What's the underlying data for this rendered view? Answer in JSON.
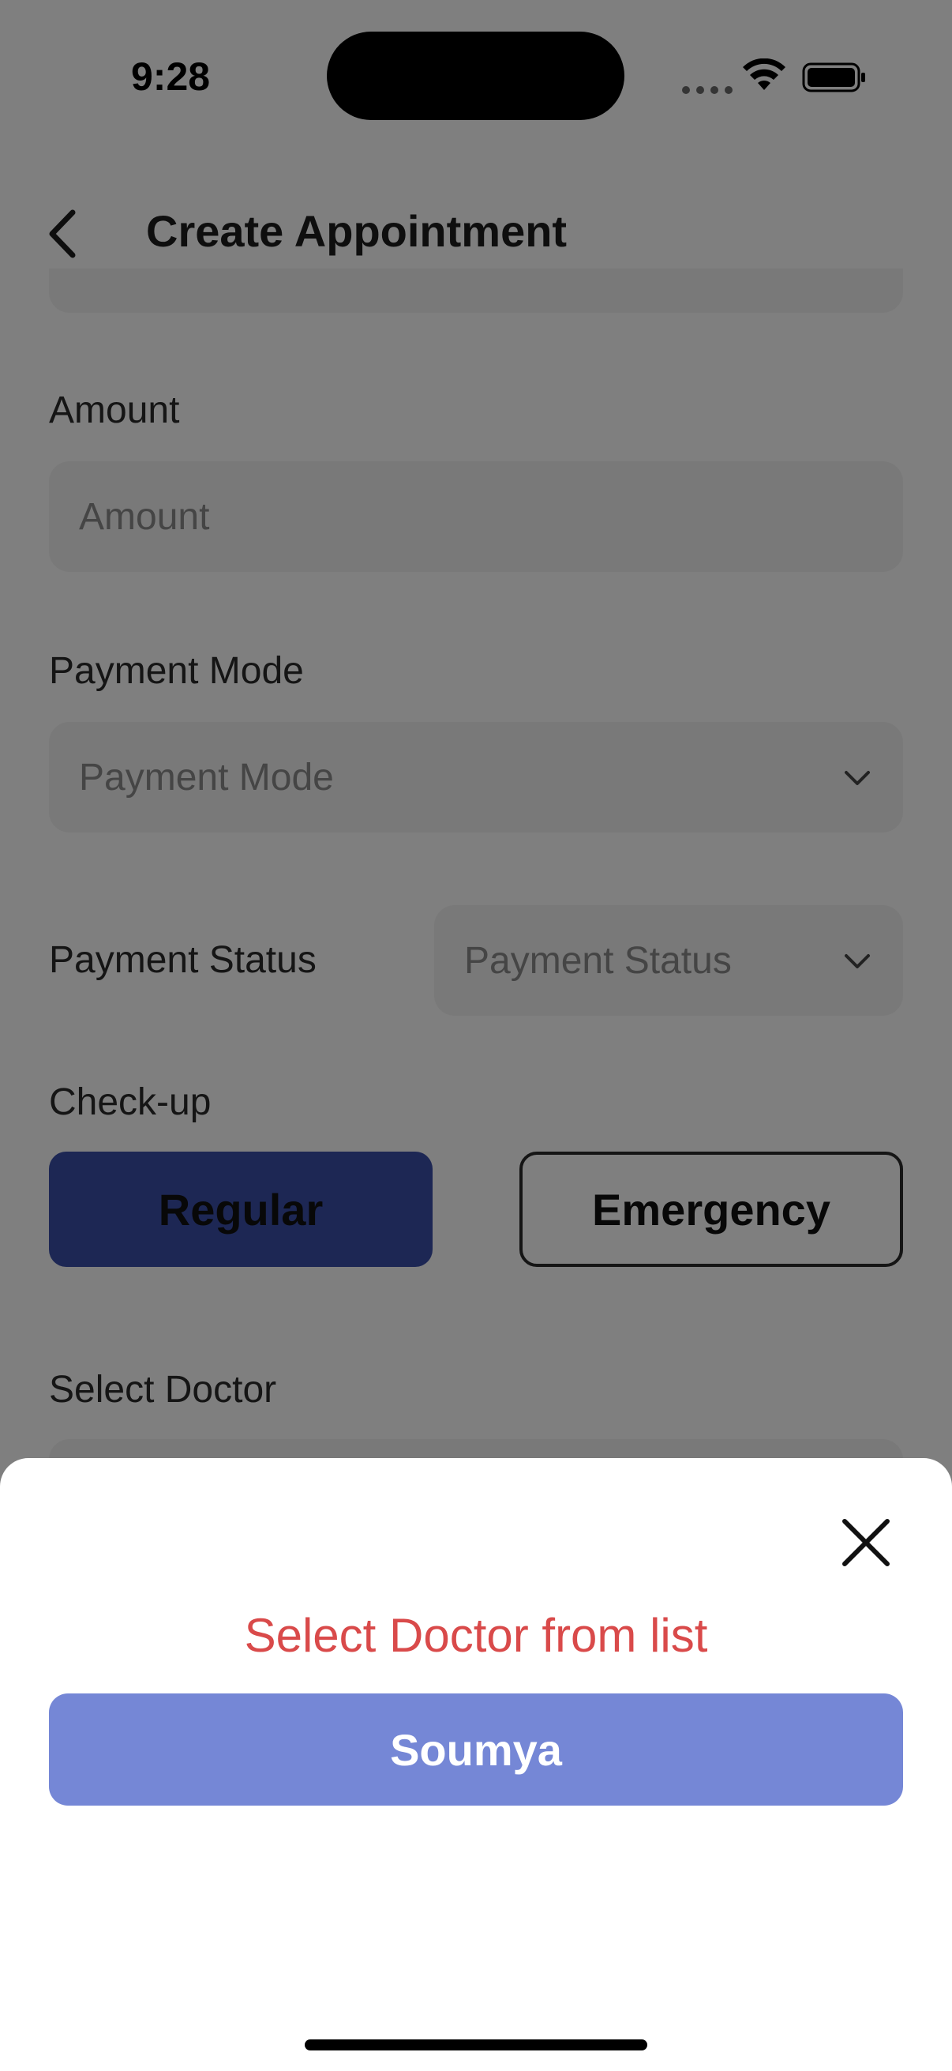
{
  "status_bar": {
    "time": "9:28"
  },
  "header": {
    "title": "Create Appointment"
  },
  "form": {
    "amount": {
      "label": "Amount",
      "placeholder": "Amount"
    },
    "payment_mode": {
      "label": "Payment Mode",
      "placeholder": "Payment Mode"
    },
    "payment_status": {
      "label": "Payment Status",
      "placeholder": "Payment Status"
    },
    "checkup": {
      "label": "Check-up",
      "options": [
        "Regular",
        "Emergency"
      ],
      "selected": "Regular"
    },
    "select_doctor": {
      "label": "Select Doctor"
    }
  },
  "sheet": {
    "title": "Select Doctor from list",
    "doctors": [
      "Soumya"
    ]
  },
  "colors": {
    "accent": "#3a4ea8",
    "option_bg": "#7587d6",
    "error_text": "#d94a4a",
    "input_bg": "#f2f2f2"
  },
  "icons": [
    "back-chevron-icon",
    "chevron-down-icon",
    "close-icon",
    "wifi-icon",
    "battery-icon",
    "cellular-signal-icon"
  ]
}
